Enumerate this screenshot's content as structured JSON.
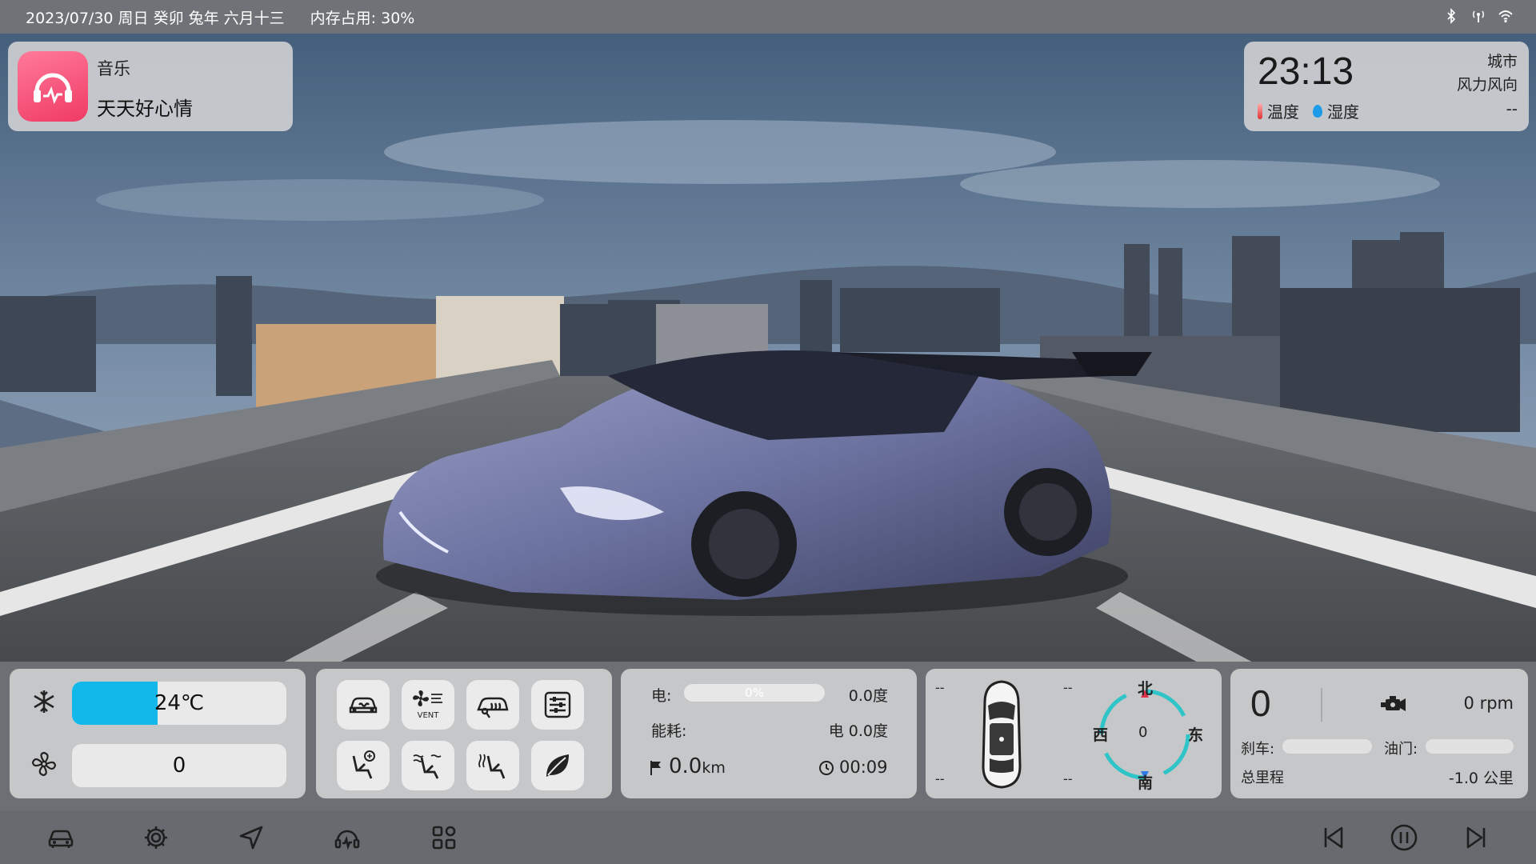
{
  "status_bar": {
    "date": "2023/07/30 周日 癸卯 兔年 六月十三",
    "memory": "内存占用: 30%",
    "icons": [
      "bluetooth-icon",
      "signal-icon",
      "wifi-icon"
    ]
  },
  "music_widget": {
    "source": "音乐",
    "song": "天天好心情",
    "icon": "music-app-icon",
    "accent": "#f03a64"
  },
  "weather_widget": {
    "time": "23:13",
    "city": "城市",
    "wind_label": "风力风向",
    "temperature_label": "温度",
    "humidity_label": "湿度",
    "value": "--"
  },
  "climate": {
    "temperature": "24℃",
    "temperature_level": 0.4,
    "fan_speed": "0",
    "accent": "#13b8ea"
  },
  "quick_buttons": [
    {
      "name": "front-defrost-button",
      "icon": "car-front-defrost-icon"
    },
    {
      "name": "vent-button",
      "icon": "fan-vent-icon",
      "label": "VENT"
    },
    {
      "name": "rear-defrost-button",
      "icon": "rear-defrost-icon"
    },
    {
      "name": "settings-sliders-button",
      "icon": "sliders-icon"
    },
    {
      "name": "seat-heat-upper-button",
      "icon": "seat-airflow-upper-icon"
    },
    {
      "name": "seat-heat-both-button",
      "icon": "seat-airflow-both-icon"
    },
    {
      "name": "seat-heat-lower-button",
      "icon": "seat-airflow-lower-icon"
    },
    {
      "name": "eco-mode-button",
      "icon": "leaf-icon"
    }
  ],
  "energy": {
    "electric_label": "电:",
    "battery_percent": "0%",
    "electric_value": "0.0度",
    "consumption_label": "能耗:",
    "consumption_value": "电 0.0度",
    "distance_value": "0.0",
    "distance_unit": "km",
    "trip_time": "00:09"
  },
  "navigation": {
    "tire_front_left": "--",
    "tire_front_right": "--",
    "tire_rear_left": "--",
    "tire_rear_right": "--",
    "north": "北",
    "south": "南",
    "east": "东",
    "west": "西",
    "heading": "0",
    "ring_color": "#2ec4c8"
  },
  "engine": {
    "speed": "0",
    "rpm": "0 rpm",
    "brake_label": "刹车:",
    "throttle_label": "油门:",
    "odometer_label": "总里程",
    "odometer_value": "-1.0 公里"
  },
  "nav_bar": {
    "left": [
      "car-icon",
      "gear-icon",
      "navigation-arrow-icon",
      "music-headphones-icon",
      "apps-grid-icon"
    ],
    "right": [
      "previous-track-icon",
      "pause-icon",
      "next-track-icon"
    ]
  }
}
